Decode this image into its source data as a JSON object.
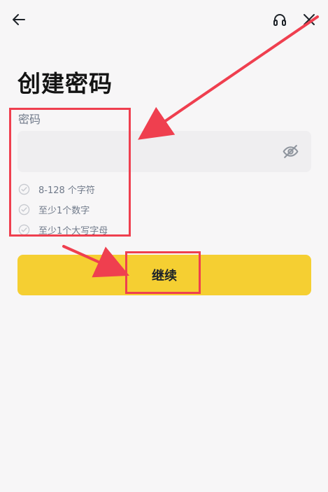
{
  "header": {
    "back_icon": "left-arrow-icon",
    "support_icon": "headset-icon",
    "close_icon": "close-icon"
  },
  "page": {
    "title": "创建密码"
  },
  "password": {
    "label": "密码",
    "value": "",
    "placeholder": "",
    "visibility_icon": "eye-off-icon"
  },
  "requirements": [
    {
      "text": "8-128 个字符",
      "icon": "check-circle-icon"
    },
    {
      "text": "至少1个数字",
      "icon": "check-circle-icon"
    },
    {
      "text": "至少1个大写字母",
      "icon": "check-circle-icon"
    }
  ],
  "continue": {
    "label": "继续"
  },
  "colors": {
    "background": "#f7f6f7",
    "input_background": "#efeef0",
    "primary": "#f5cf32",
    "annotation": "#ef3f4f",
    "muted_text": "#707a8a"
  }
}
